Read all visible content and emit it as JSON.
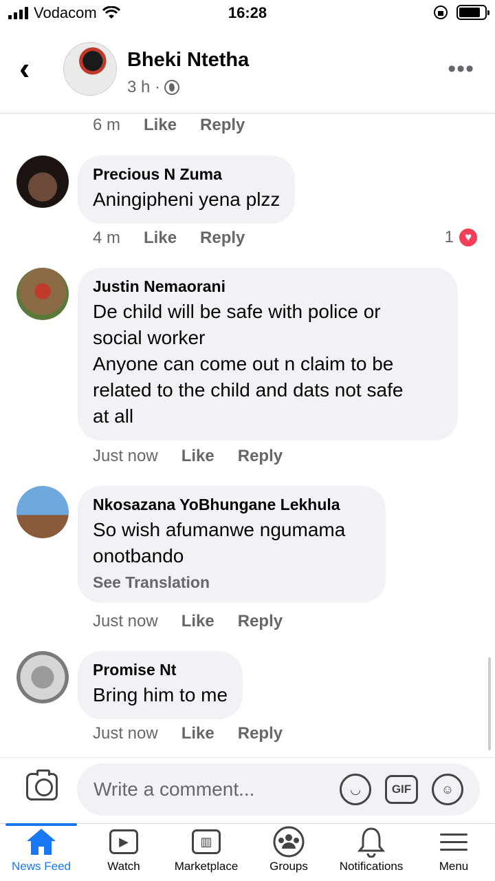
{
  "status_bar": {
    "carrier": "Vodacom",
    "time": "16:28"
  },
  "header": {
    "name": "Bheki Ntetha",
    "meta": "3 h ·"
  },
  "comments": [
    {
      "time": "6 m",
      "like": "Like",
      "reply": "Reply"
    },
    {
      "author": "Precious N Zuma",
      "text": "Aningipheni yena plzz",
      "time": "4 m",
      "like": "Like",
      "reply": "Reply",
      "reactions": "1"
    },
    {
      "author": "Justin Nemaorani",
      "text": "De child will be safe with police or\nsocial worker\nAnyone can come out n claim to be\nrelated to the child and dats not safe\nat all",
      "time": "Just now",
      "like": "Like",
      "reply": "Reply"
    },
    {
      "author": "Nkosazana YoBhungane Lekhula",
      "text": "So wish afumanwe ngumama\nonotbando",
      "translate": "See Translation",
      "time": "Just now",
      "like": "Like",
      "reply": "Reply"
    },
    {
      "author": "Promise Nt",
      "text": "Bring him to me",
      "time": "Just now",
      "like": "Like",
      "reply": "Reply"
    }
  ],
  "composer": {
    "placeholder": "Write a comment...",
    "gif_label": "GIF"
  },
  "tabs": [
    {
      "label": "News Feed",
      "icon": "home-icon",
      "active": true
    },
    {
      "label": "Watch",
      "icon": "watch-icon"
    },
    {
      "label": "Marketplace",
      "icon": "marketplace-icon"
    },
    {
      "label": "Groups",
      "icon": "groups-icon"
    },
    {
      "label": "Notifications",
      "icon": "bell-icon"
    },
    {
      "label": "Menu",
      "icon": "menu-icon"
    }
  ],
  "colors": {
    "accent": "#1877f2",
    "bubble": "#f0f2f5",
    "heart": "#f33e58",
    "muted": "#65676b"
  }
}
